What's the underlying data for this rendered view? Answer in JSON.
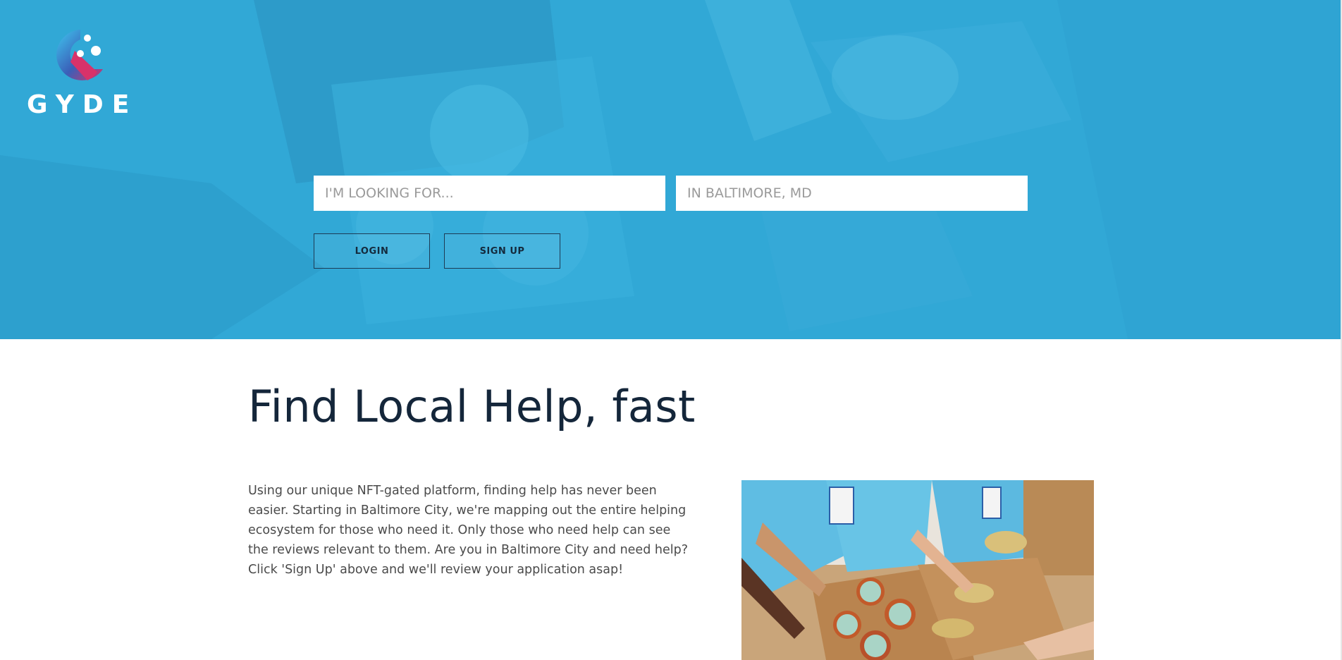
{
  "brand": {
    "name": "GYDE",
    "logo_icon": "gyde-logo-icon"
  },
  "hero": {
    "search": {
      "what_placeholder": "I'M LOOKING FOR...",
      "where_placeholder": "IN BALTIMORE, MD"
    },
    "buttons": {
      "login": "LOGIN",
      "signup": "SIGN UP"
    },
    "overlay_color": "#2fa7d6"
  },
  "main": {
    "headline": "Find Local Help, fast",
    "description": "Using our unique NFT-gated platform, finding help has never been easier. Starting in Baltimore City, we're mapping out the entire helping ecosystem for those who need it. Only those who need help can see the reviews relevant to them. Are you in Baltimore City and need help? Click 'Sign Up' above and we'll review your application asap!"
  },
  "colors": {
    "headline": "#14263a",
    "body_text": "#4a4a4a",
    "button_border": "#1d3b55"
  }
}
